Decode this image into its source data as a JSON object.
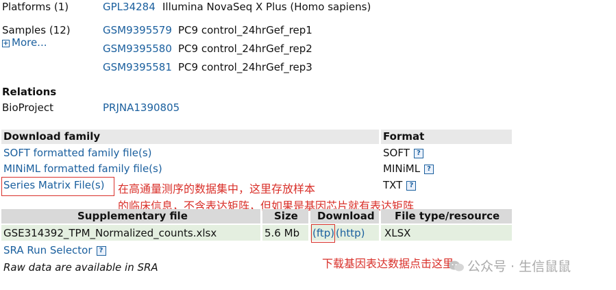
{
  "platforms": {
    "label": "Platforms (1)",
    "id": "GPL34284",
    "desc": "Illumina NovaSeq X Plus (Homo sapiens)"
  },
  "samples": {
    "label": "Samples (12)",
    "more": "More...",
    "items": [
      {
        "id": "GSM9395579",
        "desc": "PC9 control_24hrGef_rep1"
      },
      {
        "id": "GSM9395580",
        "desc": "PC9 control_24hrGef_rep2"
      },
      {
        "id": "GSM9395581",
        "desc": "PC9 control_24hrGef_rep3"
      }
    ]
  },
  "relations": {
    "heading": "Relations",
    "bioproject_label": "BioProject",
    "bioproject_id": "PRJNA1390805"
  },
  "download_family": {
    "header": "Download family",
    "format_header": "Format",
    "rows": [
      {
        "name": "SOFT formatted family file(s)",
        "format": "SOFT"
      },
      {
        "name": "MINiML formatted family file(s)",
        "format": "MINiML"
      },
      {
        "name": "Series Matrix File(s)",
        "format": "TXT"
      }
    ]
  },
  "annotation_1": {
    "line1": "在高通量测序的数据集中，这里存放样本",
    "line2": "的临床信息，不含表达矩阵，但如果是基因芯片就有表达矩阵"
  },
  "supplementary": {
    "headers": {
      "file": "Supplementary file",
      "size": "Size",
      "download": "Download",
      "type": "File type/resource"
    },
    "row": {
      "file": "GSE314392_TPM_Normalized_counts.xlsx",
      "size": "5.6 Mb",
      "ftp": "(ftp)",
      "http": "(http)",
      "type": "XLSX"
    }
  },
  "sra_selector": "SRA Run Selector",
  "raw_note": "Raw data are available in SRA",
  "annotation_2": "下载基因表达数据点击这里",
  "watermark": "公众号 · 生信鼠鼠",
  "icons": {
    "help": "?",
    "expand": "+"
  },
  "colors": {
    "link": "#1a5f9e",
    "annotation_red": "#d9302a",
    "header_bg": "#e8e8e8",
    "row_bg": "#e4efe0"
  }
}
